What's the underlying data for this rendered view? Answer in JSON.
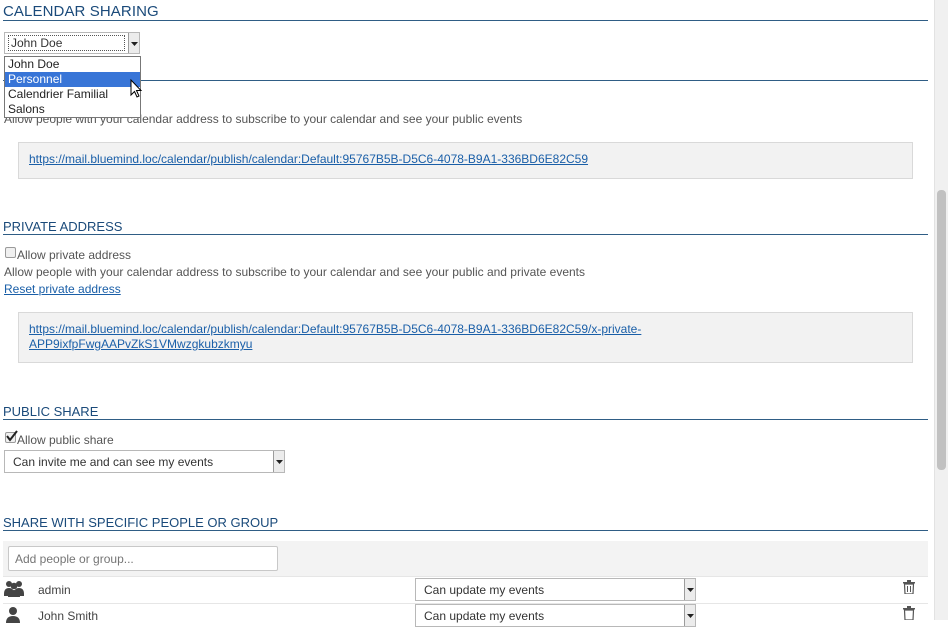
{
  "title": "CALENDAR SHARING",
  "calendar_select": {
    "value": "John Doe",
    "options": [
      "John Doe",
      "Personnel",
      "Calendrier Familial",
      "Salons"
    ],
    "highlighted": "Personnel"
  },
  "public_address": {
    "description": "Allow people with your calendar address to subscribe to your calendar and see your public events",
    "url": "https://mail.bluemind.loc/calendar/publish/calendar:Default:95767B5B-D5C6-4078-B9A1-336BD6E82C59"
  },
  "private_address": {
    "heading": "PRIVATE ADDRESS",
    "checkbox_label": "Allow private address",
    "description": "Allow people with your calendar address to subscribe to your calendar and see your public and private events",
    "reset_link": "Reset private address",
    "url_line1": "https://mail.bluemind.loc/calendar/publish/calendar:Default:95767B5B-D5C6-4078-B9A1-336BD6E82C59/x-private-",
    "url_line2": "APP9ixfpFwgAAPvZkS1VMwzgkubzkmyu"
  },
  "public_share": {
    "heading": "PUBLIC SHARE",
    "checkbox_label": "Allow public share",
    "checked": true,
    "permission": "Can invite me and can see my events"
  },
  "specific_share": {
    "heading": "SHARE WITH SPECIFIC PEOPLE OR GROUP",
    "add_placeholder": "Add people or group...",
    "rows": [
      {
        "name": "admin",
        "type": "group",
        "permission": "Can update my events"
      },
      {
        "name": "John Smith",
        "type": "user",
        "permission": "Can update my events"
      }
    ]
  },
  "colors": {
    "heading": "#1a4a7a",
    "link": "#1a5fa8",
    "selection": "#3875d7"
  }
}
